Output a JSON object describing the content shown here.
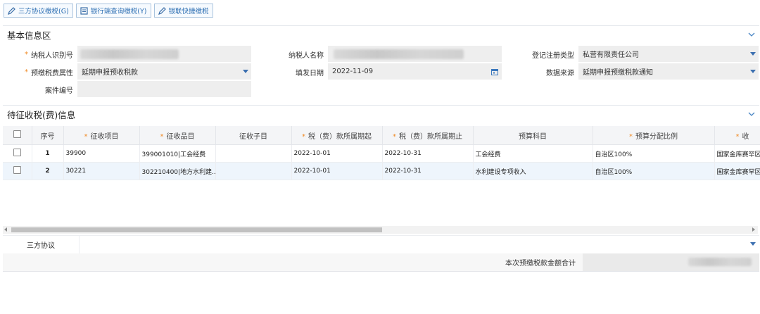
{
  "toolbar": {
    "btn1": "三方协议缴税(G)",
    "btn2": "银行端查询缴税(Y)",
    "btn3": "银联快捷缴税"
  },
  "basic": {
    "title": "基本信息区",
    "taxpayer_id_label": "纳税人识别号",
    "taxpayer_name_label": "纳税人名称",
    "reg_type_label": "登记注册类型",
    "reg_type_value": "私营有限责任公司",
    "prepay_attr_label": "预缴税费属性",
    "prepay_attr_value": "延期申报预收税款",
    "fill_date_label": "填发日期",
    "fill_date_value": "2022-11-09",
    "data_source_label": "数据来源",
    "data_source_value": "延期申报预缴税款通知",
    "case_no_label": "案件编号"
  },
  "pending": {
    "title": "待征收税(费)信息",
    "headers": [
      "序号",
      "征收项目",
      "征收品目",
      "征收子目",
      "税（费）款所属期起",
      "税（费）款所属期止",
      "预算科目",
      "预算分配比例",
      "收"
    ],
    "rows": [
      {
        "no": "1",
        "item": "39900",
        "sub": "399001010|工会经费",
        "child": "",
        "start": "2022-10-01",
        "end": "2022-10-31",
        "budget": "工会经费",
        "ratio": "自治区100%",
        "treasury": "国家金库赛罕区"
      },
      {
        "no": "2",
        "item": "30221",
        "sub": "302210400|地方水利建...",
        "child": "",
        "start": "2022-10-01",
        "end": "2022-10-31",
        "budget": "水利建设专项收入",
        "ratio": "自治区100%",
        "treasury": "国家金库赛罕区"
      }
    ]
  },
  "tripartite_label": "三方协议",
  "total_label": "本次预缴税款金额合计",
  "colors": {
    "accent": "#2d6fb3",
    "required": "#f08a24",
    "field_bg": "#eeeeee"
  }
}
